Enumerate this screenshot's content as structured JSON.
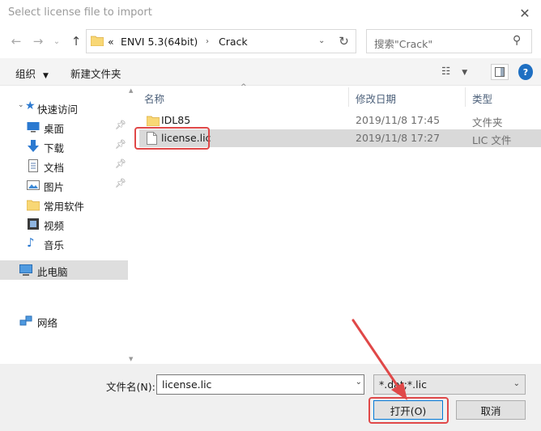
{
  "window": {
    "title": "Select license file to import"
  },
  "address": {
    "overflow": "«",
    "crumbs": [
      "ENVI 5.3(64bit)",
      "Crack"
    ]
  },
  "search": {
    "placeholder": "搜索\"Crack\""
  },
  "toolbar": {
    "organize": "组织",
    "new_folder": "新建文件夹"
  },
  "sidebar": {
    "quick_access": "快速访问",
    "items": [
      {
        "label": "桌面",
        "icon": "desktop-icon",
        "pinned": true
      },
      {
        "label": "下载",
        "icon": "download-icon",
        "pinned": true
      },
      {
        "label": "文档",
        "icon": "document-icon",
        "pinned": true
      },
      {
        "label": "图片",
        "icon": "picture-icon",
        "pinned": true
      },
      {
        "label": "常用软件",
        "icon": "folder-icon",
        "pinned": false
      },
      {
        "label": "视频",
        "icon": "video-icon",
        "pinned": false
      },
      {
        "label": "音乐",
        "icon": "music-icon",
        "pinned": false
      }
    ],
    "this_pc": "此电脑",
    "network": "网络"
  },
  "columns": {
    "name": "名称",
    "modified": "修改日期",
    "type": "类型"
  },
  "files": [
    {
      "name": "IDL85",
      "modified": "2019/11/8 17:45",
      "type": "文件夹",
      "icon": "folder-icon"
    },
    {
      "name": "license.lic",
      "modified": "2019/11/8 17:27",
      "type": "LIC 文件",
      "icon": "file-icon"
    }
  ],
  "bottom": {
    "filename_label": "文件名(N):",
    "filename_value": "license.lic",
    "filter_value": "*.dat;*.lic",
    "open_label": "打开(O)",
    "cancel_label": "取消"
  },
  "colors": {
    "highlight": "#e04848",
    "accent": "#0078d7",
    "selection": "#d9d9d9"
  }
}
